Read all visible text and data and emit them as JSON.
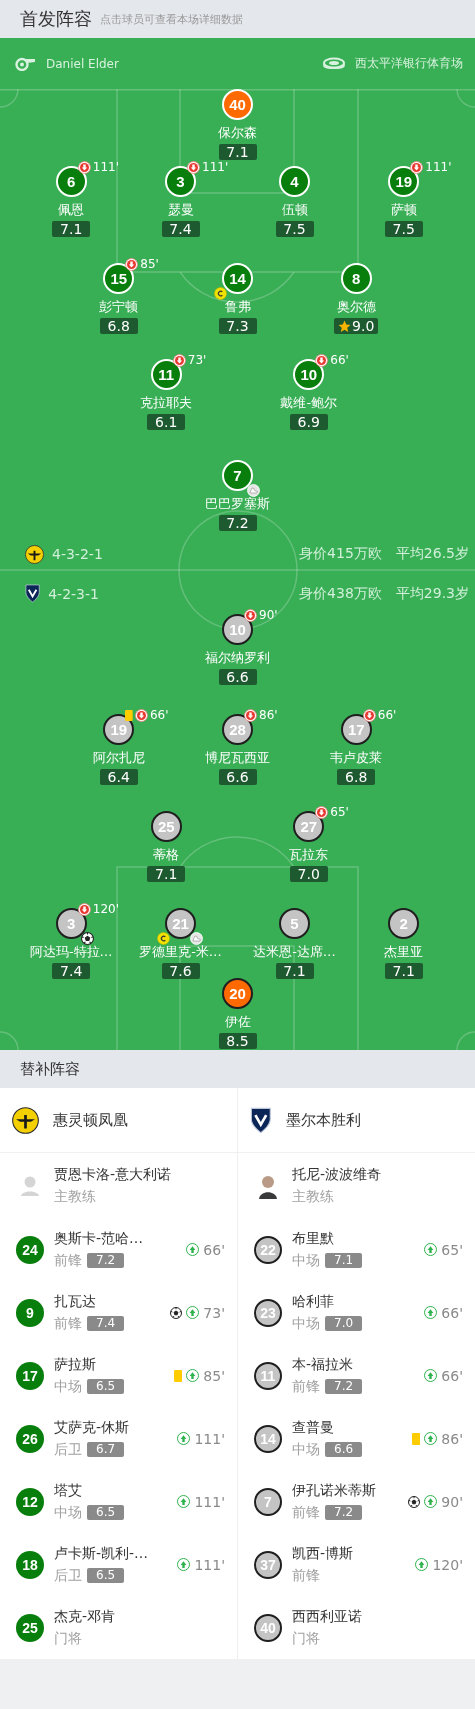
{
  "header": {
    "title": "首发阵容",
    "hint": "点击球员可查看本场详细数据"
  },
  "match_info": {
    "referee": "Daniel Elder",
    "venue": "西太平洋银行体育场"
  },
  "home": {
    "kind": "home",
    "formation": "4-3-2-1",
    "market_value": "身价415万欧",
    "average_age": "平均26.5岁",
    "rows": [
      [
        {
          "number": "40",
          "name": "保尔森",
          "rating": "7.1",
          "color": "#ff6a00",
          "best": false
        }
      ],
      [
        {
          "number": "6",
          "name": "佩恩",
          "rating": "7.1",
          "color": "#087f0c",
          "sub_off": "111'",
          "best": false
        },
        {
          "number": "3",
          "name": "瑟曼",
          "rating": "7.4",
          "color": "#087f0c",
          "sub_off": "111'",
          "best": false
        },
        {
          "number": "4",
          "name": "伍顿",
          "rating": "7.5",
          "color": "#087f0c",
          "best": false
        },
        {
          "number": "19",
          "name": "萨顿",
          "rating": "7.5",
          "color": "#087f0c",
          "sub_off": "111'",
          "best": false
        }
      ],
      [
        {
          "number": "15",
          "name": "彭宁顿",
          "rating": "6.8",
          "color": "#087f0c",
          "sub_off": "85'",
          "best": false
        },
        {
          "number": "14",
          "name": "鲁弗",
          "rating": "7.3",
          "color": "#087f0c",
          "marks": [
            {
              "kind": "captain"
            }
          ],
          "best": false
        },
        {
          "number": "8",
          "name": "奥尔德",
          "rating": "9.0",
          "color": "#087f0c",
          "best": true
        }
      ],
      [
        {
          "number": "11",
          "name": "克拉耶夫",
          "rating": "6.1",
          "color": "#087f0c",
          "sub_off": "73'",
          "best": false
        },
        {
          "number": "10",
          "name": "戴维-鲍尔",
          "rating": "6.9",
          "color": "#087f0c",
          "sub_off": "66'",
          "best": false
        }
      ],
      [
        {
          "number": "7",
          "name": "巴巴罗塞斯",
          "rating": "7.2",
          "color": "#087f0c",
          "marks": [
            {
              "kind": "assist"
            }
          ],
          "best": false
        }
      ]
    ]
  },
  "away": {
    "kind": "away",
    "formation": "4-2-3-1",
    "market_value": "身价438万欧",
    "average_age": "平均29.3岁",
    "rows": [
      [
        {
          "number": "10",
          "name": "福尔纳罗利",
          "rating": "6.6",
          "color": "#c4c4c4",
          "sub_off": "90'",
          "best": false
        }
      ],
      [
        {
          "number": "19",
          "name": "阿尔扎尼",
          "rating": "6.4",
          "color": "#c4c4c4",
          "sub_off": "66'",
          "marks": [
            {
              "kind": "booking"
            }
          ],
          "best": false
        },
        {
          "number": "28",
          "name": "博尼瓦西亚",
          "rating": "6.6",
          "color": "#c4c4c4",
          "sub_off": "86'",
          "best": false
        },
        {
          "number": "17",
          "name": "韦卢皮莱",
          "rating": "6.8",
          "color": "#c4c4c4",
          "sub_off": "66'",
          "best": false
        }
      ],
      [
        {
          "number": "25",
          "name": "蒂格",
          "rating": "7.1",
          "color": "#c4c4c4",
          "best": false
        },
        {
          "number": "27",
          "name": "瓦拉东",
          "rating": "7.0",
          "color": "#c4c4c4",
          "sub_off": "65'",
          "best": false
        }
      ],
      [
        {
          "number": "3",
          "name": "阿达玛-特拉…",
          "rating": "7.4",
          "color": "#c4c4c4",
          "sub_off": "120'",
          "marks": [
            {
              "kind": "goal"
            }
          ],
          "best": false
        },
        {
          "number": "21",
          "name": "罗德里克-米…",
          "rating": "7.6",
          "color": "#c4c4c4",
          "marks": [
            {
              "kind": "captain"
            },
            {
              "kind": "assist"
            }
          ],
          "best": false
        },
        {
          "number": "5",
          "name": "达米恩-达席…",
          "rating": "7.1",
          "color": "#c4c4c4",
          "best": false
        },
        {
          "number": "2",
          "name": "杰里亚",
          "rating": "7.1",
          "color": "#c4c4c4",
          "best": false
        }
      ],
      [
        {
          "number": "20",
          "name": "伊佐",
          "rating": "8.5",
          "color": "#ff6a00",
          "best": false
        }
      ]
    ]
  },
  "substitutes": {
    "title": "替补阵容",
    "teams": [
      {
        "name": "惠灵顿凤凰",
        "kind": "home",
        "coach": {
          "name": "贾恩卡洛-意大利诺",
          "role": "主教练",
          "kind": "placeholder"
        },
        "players": [
          {
            "number": "24",
            "name": "奥斯卡-范哈…",
            "position": "前锋",
            "rating": "7.2",
            "minute": "66'",
            "color": "#087f0c"
          },
          {
            "number": "9",
            "name": "扎瓦达",
            "position": "前锋",
            "rating": "7.4",
            "minute": "73'",
            "marks": [
              {
                "kind": "goal"
              }
            ],
            "color": "#087f0c"
          },
          {
            "number": "17",
            "name": "萨拉斯",
            "position": "中场",
            "rating": "6.5",
            "minute": "85'",
            "marks": [
              {
                "kind": "booking"
              }
            ],
            "color": "#087f0c"
          },
          {
            "number": "26",
            "name": "艾萨克-休斯",
            "position": "后卫",
            "rating": "6.7",
            "minute": "111'",
            "color": "#087f0c"
          },
          {
            "number": "12",
            "name": "塔艾",
            "position": "中场",
            "rating": "6.5",
            "minute": "111'",
            "color": "#087f0c"
          },
          {
            "number": "18",
            "name": "卢卡斯-凯利-…",
            "position": "后卫",
            "rating": "6.5",
            "minute": "111'",
            "color": "#087f0c"
          },
          {
            "number": "25",
            "name": "杰克-邓肯",
            "position": "门将",
            "color": "#087f0c"
          }
        ]
      },
      {
        "name": "墨尔本胜利",
        "kind": "away",
        "coach": {
          "name": "托尼-波波维奇",
          "role": "主教练",
          "kind": "photo"
        },
        "players": [
          {
            "number": "22",
            "name": "布里默",
            "position": "中场",
            "rating": "7.1",
            "minute": "65'",
            "color": "#c4c4c4"
          },
          {
            "number": "23",
            "name": "哈利菲",
            "position": "中场",
            "rating": "7.0",
            "minute": "66'",
            "color": "#c4c4c4"
          },
          {
            "number": "11",
            "name": "本-福拉米",
            "position": "前锋",
            "rating": "7.2",
            "minute": "66'",
            "color": "#c4c4c4"
          },
          {
            "number": "14",
            "name": "查普曼",
            "position": "中场",
            "rating": "6.6",
            "minute": "86'",
            "marks": [
              {
                "kind": "booking"
              }
            ],
            "color": "#c4c4c4"
          },
          {
            "number": "7",
            "name": "伊孔诺米蒂斯",
            "position": "前锋",
            "rating": "7.2",
            "minute": "90'",
            "marks": [
              {
                "kind": "goal"
              }
            ],
            "color": "#c4c4c4"
          },
          {
            "number": "37",
            "name": "凯西-博斯",
            "position": "前锋",
            "minute": "120'",
            "color": "#c4c4c4"
          },
          {
            "number": "40",
            "name": "西西利亚诺",
            "position": "门将",
            "color": "#c4c4c4"
          }
        ]
      }
    ]
  }
}
